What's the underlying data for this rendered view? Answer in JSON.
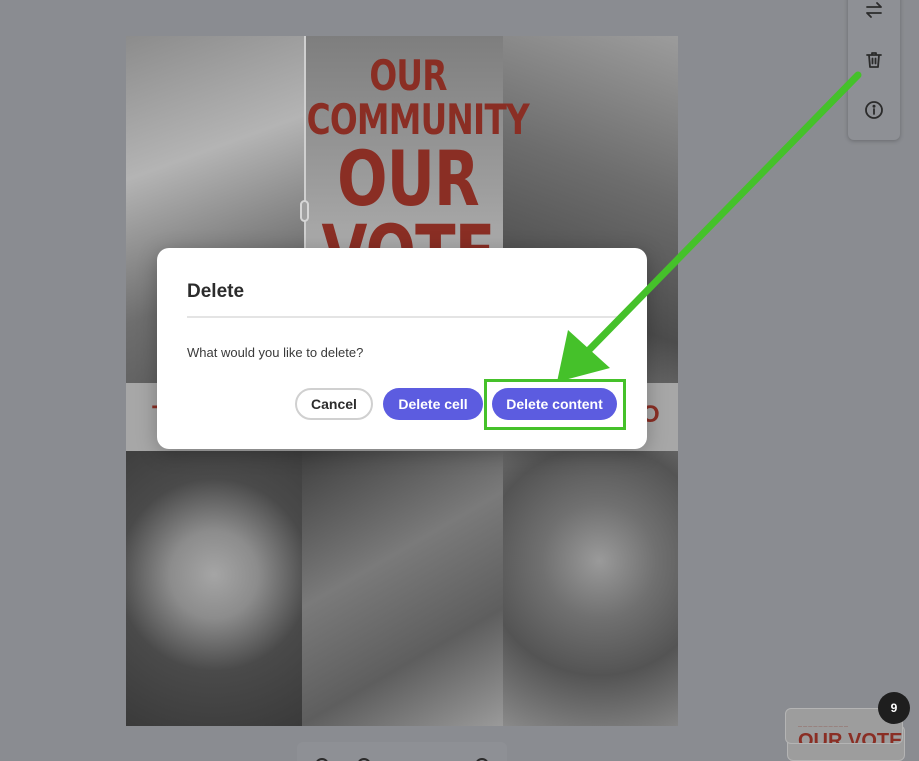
{
  "poster": {
    "title_line1": "OUR COMMUNITY",
    "title_line2": "OUR VOTE",
    "band_left_fragment": "T",
    "band_right_fragment": "O"
  },
  "toolbar": {
    "icons": [
      "swap-icon",
      "trash-icon",
      "info-icon"
    ]
  },
  "dialog": {
    "title": "Delete",
    "message": "What would you like to delete?",
    "cancel_label": "Cancel",
    "delete_cell_label": "Delete cell",
    "delete_content_label": "Delete content"
  },
  "pages": {
    "count": "9",
    "thumbnail_title": "OUR VOTE"
  },
  "colors": {
    "primary_button": "#5c5ce0",
    "annotation": "#45c12a",
    "poster_red": "#8a2e24"
  }
}
